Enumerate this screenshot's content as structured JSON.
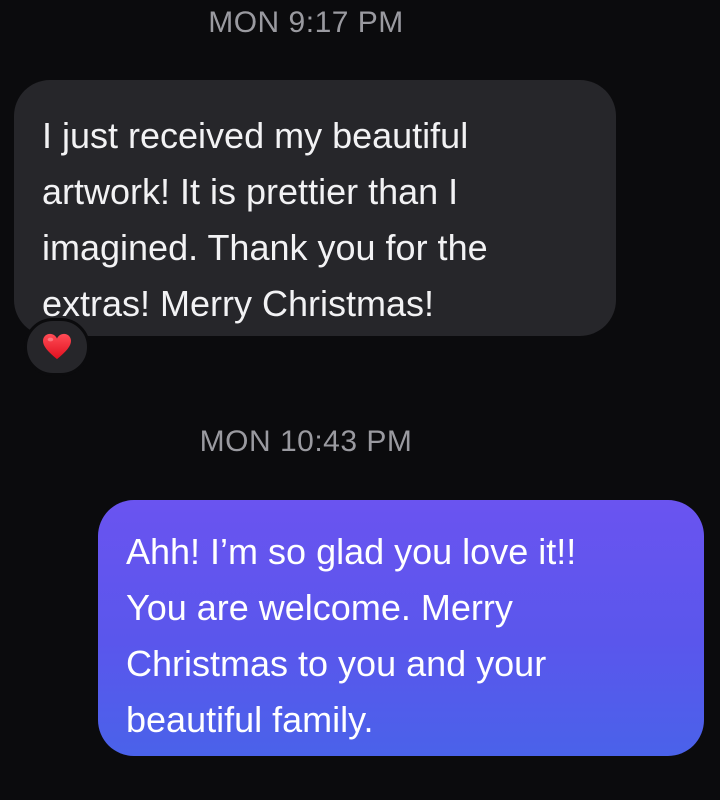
{
  "conversation": {
    "messages": [
      {
        "timestamp": "MON 9:17 PM",
        "direction": "incoming",
        "text": "I just received my beautiful\nartwork! It is prettier than I\nimagined. Thank you for the\nextras! Merry Christmas!",
        "reaction_icon": "heart-icon",
        "bubble_color": "#26262a"
      },
      {
        "timestamp": "MON 10:43 PM",
        "direction": "outgoing",
        "text": "Ahh! I’m so glad you love it!!\nYou are welcome. Merry\nChristmas to you and your\nbeautiful family.",
        "bubble_color": "#5a56ec"
      }
    ]
  },
  "colors": {
    "background": "#0b0b0d",
    "timestamp": "#9a9aa0",
    "reaction_heart": "#ff2d3a"
  }
}
